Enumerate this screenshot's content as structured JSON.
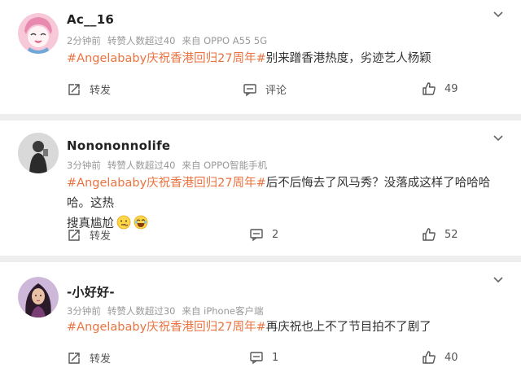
{
  "posts": [
    {
      "username": "Ac__16",
      "time": "2分钟前",
      "reposts": "转赞人数超过40",
      "source": "来自 OPPO A55 5G",
      "hashtag": "#Angelababy庆祝香港回归27周年#",
      "text": "别来蹭香港热度，劣迹艺人杨颖",
      "repost_label": "转发",
      "comment_label": "评论",
      "likes": "49"
    },
    {
      "username": "Nonononnolife",
      "time": "3分钟前",
      "reposts": "转赞人数超过40",
      "source": "来自 OPPO智能手机",
      "hashtag": "#Angelababy庆祝香港回归27周年#",
      "text": "后不后悔去了风马秀？没落成这样了哈哈哈哈。这热",
      "text2": "搜真尴尬",
      "repost_label": "转发",
      "comment_count": "2",
      "likes": "52"
    },
    {
      "username": "-小好好-",
      "time": "3分钟前",
      "reposts": "转赞人数超过30",
      "source": "来自 iPhone客户端",
      "hashtag": "#Angelababy庆祝香港回归27周年#",
      "text": "再庆祝也上不了节目拍不了剧了",
      "repost_label": "转发",
      "comment_count": "1",
      "likes": "40"
    }
  ],
  "colors": {
    "hashtag": "#eb7340",
    "meta": "#999999",
    "separator": "#eeeeee"
  }
}
